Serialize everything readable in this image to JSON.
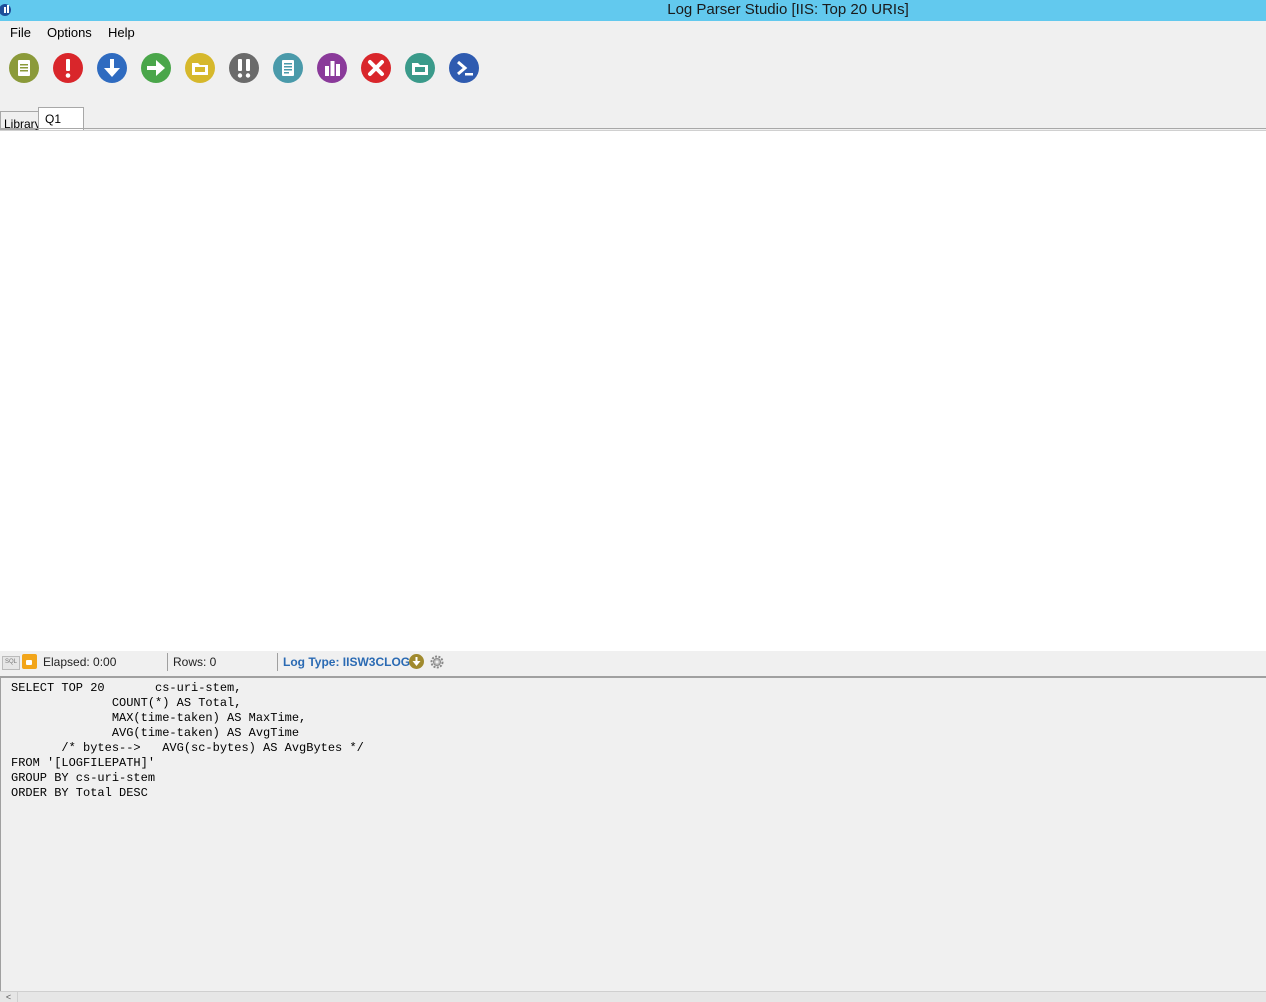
{
  "window": {
    "title": "Log Parser Studio  [IIS: Top 20 URIs]"
  },
  "menu": {
    "items": [
      "File",
      "Options",
      "Help"
    ]
  },
  "toolbar": {
    "buttons": [
      {
        "name": "new-query-button",
        "icon": "document-icon",
        "color": "#8b9a3a"
      },
      {
        "name": "run-query-button",
        "icon": "exclamation-icon",
        "color": "#d9262b"
      },
      {
        "name": "download-button",
        "icon": "down-arrow-icon",
        "color": "#2f6bc0"
      },
      {
        "name": "forward-button",
        "icon": "right-arrow-icon",
        "color": "#4aa64a"
      },
      {
        "name": "open-log-button",
        "icon": "log-folder-icon",
        "color": "#d6b82c"
      },
      {
        "name": "run-multiple-button",
        "icon": "double-exclamation-icon",
        "color": "#6b6b6b"
      },
      {
        "name": "report-button",
        "icon": "report-icon",
        "color": "#4a9aaa"
      },
      {
        "name": "chart-button",
        "icon": "bar-chart-icon",
        "color": "#8a3a9a"
      },
      {
        "name": "cancel-button",
        "icon": "close-icon",
        "color": "#d9262b"
      },
      {
        "name": "output-button",
        "icon": "output-folder-icon",
        "color": "#3a9a8a"
      },
      {
        "name": "powershell-button",
        "icon": "powershell-icon",
        "color": "#2f5bb0"
      }
    ]
  },
  "tabs": {
    "library": "Library",
    "q1": "Q1"
  },
  "status": {
    "sql_badge": "SQL",
    "elapsed": "Elapsed: 0:00",
    "rows": "Rows: 0",
    "log_type": "Log Type: IISW3CLOG"
  },
  "editor": {
    "query": "SELECT TOP 20       cs-uri-stem,\n              COUNT(*) AS Total,\n              MAX(time-taken) AS MaxTime,\n              AVG(time-taken) AS AvgTime\n       /* bytes-->   AVG(sc-bytes) AS AvgBytes */\nFROM '[LOGFILEPATH]'\nGROUP BY cs-uri-stem\nORDER BY Total DESC"
  },
  "scrollbar": {
    "left_arrow": "<"
  }
}
